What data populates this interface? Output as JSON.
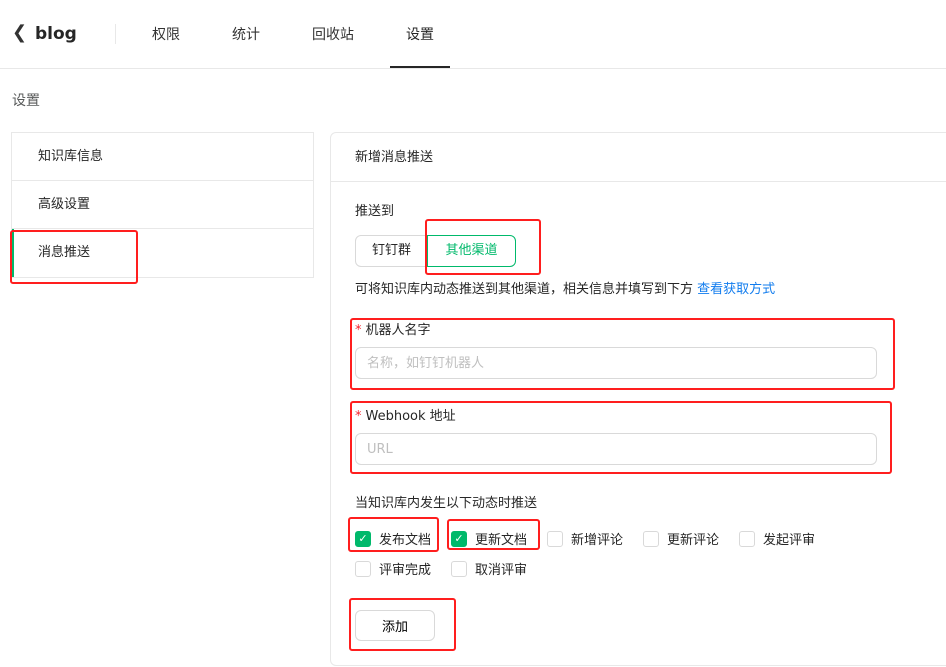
{
  "header": {
    "title": "blog",
    "tabs": [
      {
        "label": "权限"
      },
      {
        "label": "统计"
      },
      {
        "label": "回收站"
      },
      {
        "label": "设置",
        "active": true
      }
    ]
  },
  "page_title": "设置",
  "sidebar": {
    "items": [
      {
        "label": "知识库信息"
      },
      {
        "label": "高级设置"
      },
      {
        "label": "消息推送",
        "active": true
      }
    ]
  },
  "card": {
    "title": "新增消息推送",
    "push_to_label": "推送到",
    "channels": [
      {
        "label": "钉钉群"
      },
      {
        "label": "其他渠道",
        "selected": true
      }
    ],
    "description": "可将知识库内动态推送到其他渠道，相关信息并填写到下方",
    "help_link": "查看获取方式",
    "robot_name": {
      "label": "机器人名字",
      "required_mark": "*",
      "value": "",
      "placeholder": "名称，如钉钉机器人"
    },
    "webhook": {
      "label": "Webhook 地址",
      "required_mark": "*",
      "value": "",
      "placeholder": "URL"
    },
    "events_label": "当知识库内发生以下动态时推送",
    "events": [
      {
        "label": "发布文档",
        "checked": true
      },
      {
        "label": "更新文档",
        "checked": true
      },
      {
        "label": "新增评论",
        "checked": false
      },
      {
        "label": "更新评论",
        "checked": false
      },
      {
        "label": "发起评审",
        "checked": false
      },
      {
        "label": "评审完成",
        "checked": false
      },
      {
        "label": "取消评审",
        "checked": false
      }
    ],
    "add_button": "添加"
  },
  "colors": {
    "accent": "#00b96b",
    "link": "#117cee",
    "annotation": "#ff1e1e"
  }
}
